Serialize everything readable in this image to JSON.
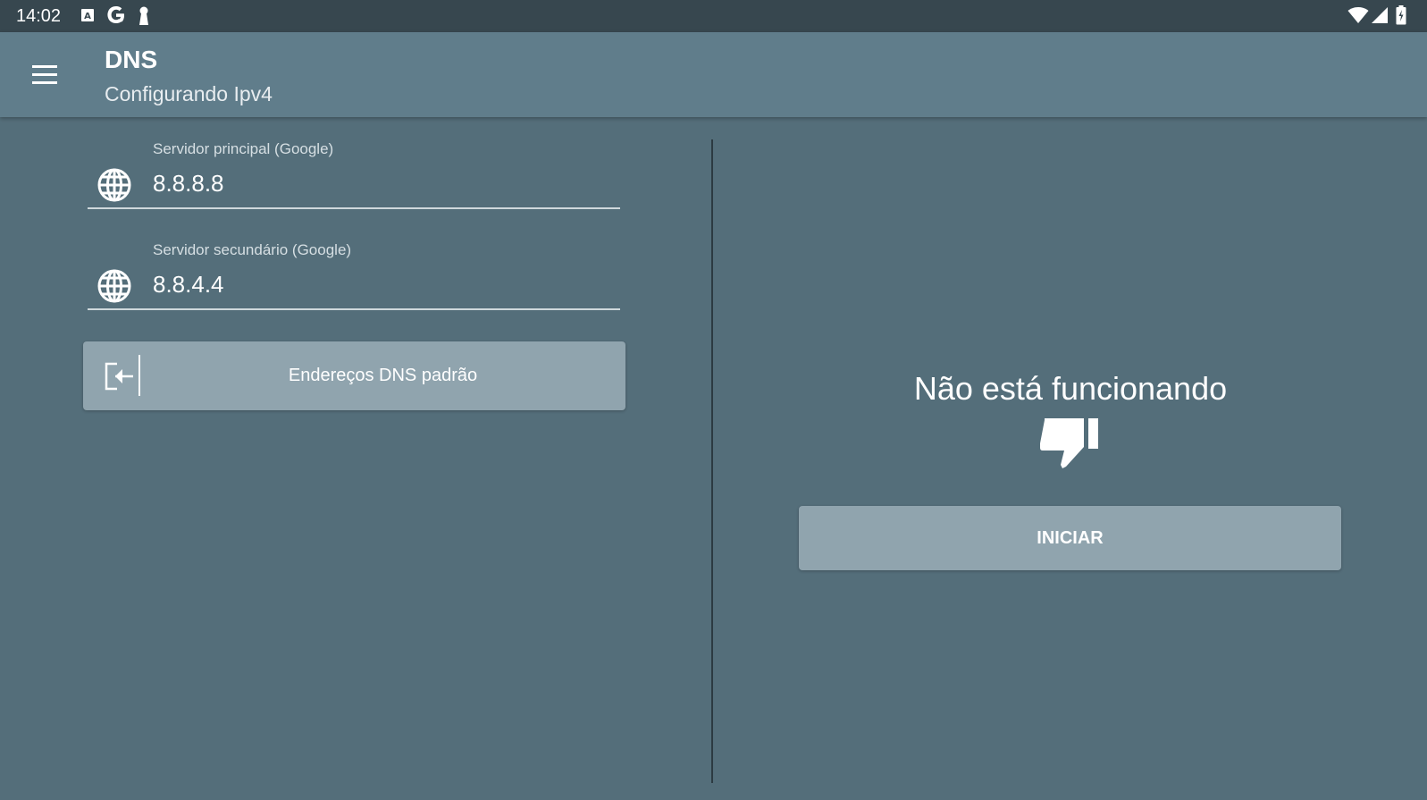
{
  "status_bar": {
    "time": "14:02",
    "left_icons": [
      "keyboard-a-icon",
      "google-g-icon",
      "keyhole-icon"
    ],
    "right_icons": [
      "wifi-icon",
      "signal-icon",
      "battery-icon"
    ]
  },
  "app_bar": {
    "menu_icon": "hamburger-menu-icon",
    "title": "DNS",
    "subtitle": "Configurando Ipv4"
  },
  "dns_form": {
    "primary": {
      "label": "Servidor principal (Google)",
      "value": "8.8.8.8",
      "icon": "globe-icon"
    },
    "secondary": {
      "label": "Servidor secundário (Google)",
      "value": "8.8.4.4",
      "icon": "globe-icon"
    },
    "default_button": {
      "label": "Endereços DNS padrão",
      "icon": "sign-in-icon"
    }
  },
  "status_panel": {
    "message": "Não está funcionando",
    "icon": "thumbs-down-icon",
    "start_button": {
      "label": "INICIAR"
    }
  },
  "colors": {
    "background": "#546e7a",
    "app_bar": "#607d8b",
    "status_bar": "#37474f",
    "button": "#90a4ae",
    "text": "#ffffff"
  }
}
